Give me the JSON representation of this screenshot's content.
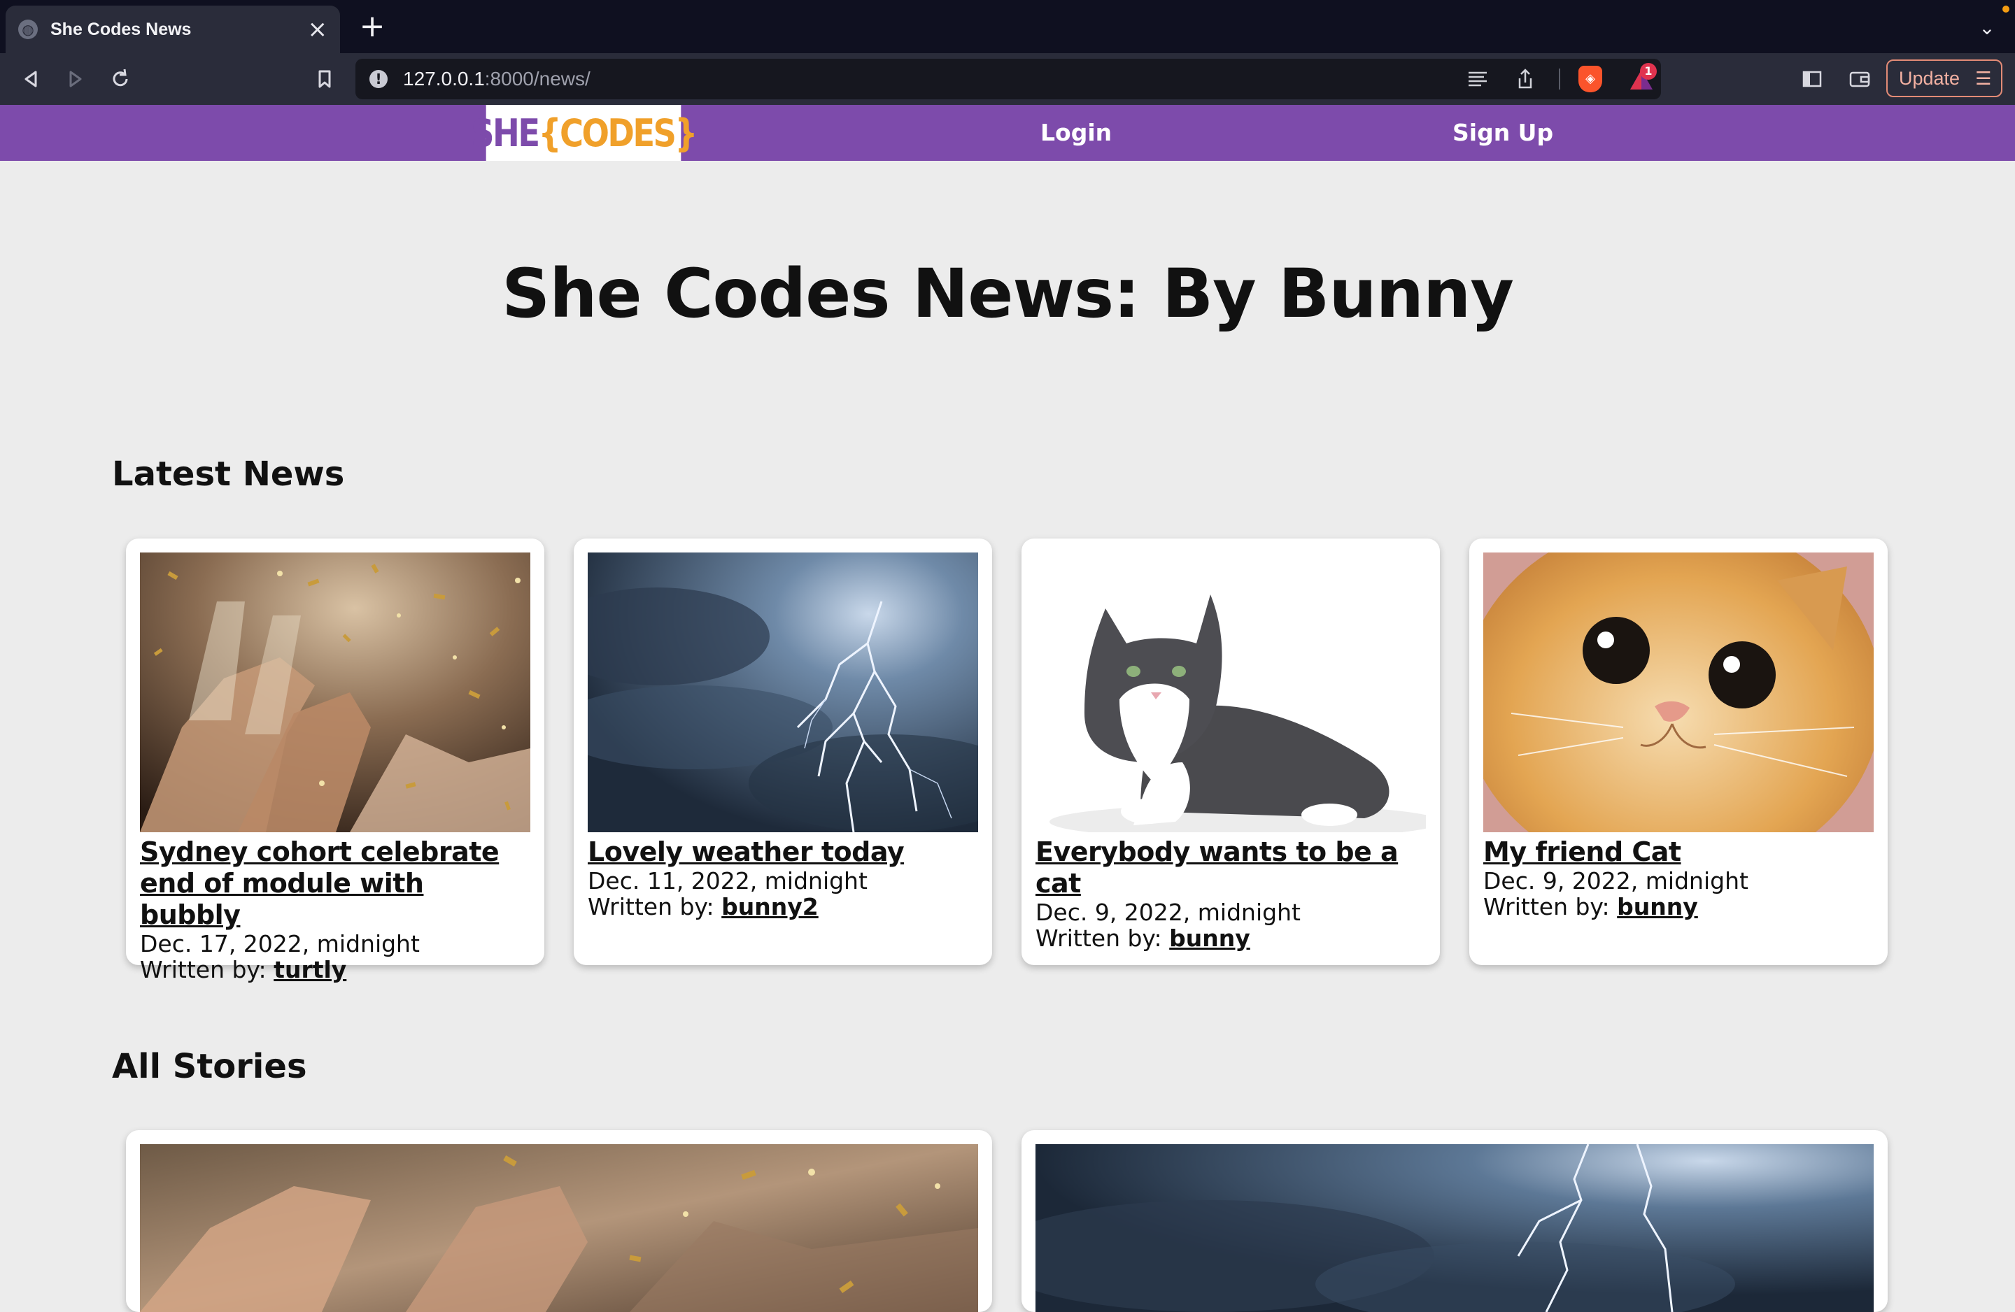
{
  "browser": {
    "tab_title": "She Codes News",
    "url_host": "127.0.0.1",
    "url_path": ":8000/news/",
    "update_label": "Update",
    "rewards_badge": "1"
  },
  "site": {
    "logo_she": "SHE",
    "logo_codes": "{CODES}",
    "nav": {
      "login": "Login",
      "signup": "Sign Up"
    }
  },
  "page": {
    "title": "She Codes News: By Bunny",
    "latest_heading": "Latest News",
    "all_heading": "All Stories"
  },
  "latest_news": [
    {
      "title": "Sydney cohort celebrate end of module with bubbly",
      "date": "Dec. 17, 2022, midnight",
      "written_by_label": "Written by:",
      "author": "turtly",
      "image": "celebration-image"
    },
    {
      "title": "Lovely weather today",
      "date": "Dec. 11, 2022, midnight",
      "written_by_label": "Written by:",
      "author": "bunny2",
      "image": "storm-image"
    },
    {
      "title": "Everybody wants to be a cat",
      "date": "Dec. 9, 2022, midnight",
      "written_by_label": "Written by:",
      "author": "bunny",
      "image": "gray-cat-image"
    },
    {
      "title": "My friend Cat",
      "date": "Dec. 9, 2022, midnight",
      "written_by_label": "Written by:",
      "author": "bunny",
      "image": "orange-cat-image"
    }
  ],
  "all_stories": [
    {
      "image": "celebration-image"
    },
    {
      "image": "storm-image"
    }
  ]
}
